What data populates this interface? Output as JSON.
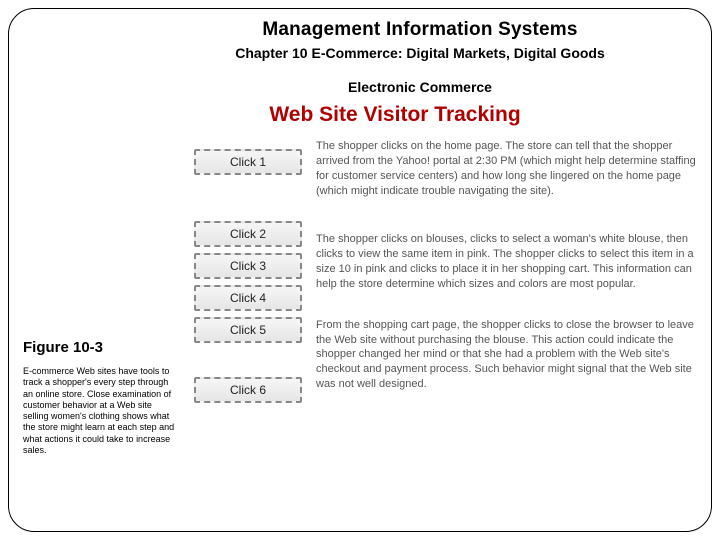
{
  "header": {
    "main": "Management Information Systems",
    "chapter": "Chapter 10 E-Commerce: Digital Markets, Digital Goods",
    "section": "Electronic Commerce",
    "topic": "Web Site Visitor Tracking"
  },
  "figure": {
    "label": "Figure 10-3",
    "caption": "E-commerce Web sites have tools to track a shopper's every step through an online store. Close examination of customer behavior at a Web site selling women's clothing shows what the store might learn at each step and what actions it could take to increase sales."
  },
  "clicks": {
    "c1": "Click 1",
    "c2": "Click 2",
    "c3": "Click 3",
    "c4": "Click 4",
    "c5": "Click 5",
    "c6": "Click 6"
  },
  "descriptions": {
    "d1": "The shopper clicks on the home page. The store can tell that the shopper arrived from the Yahoo! portal at 2:30 PM (which might help determine staffing for customer service centers) and how long she lingered on the home page (which might indicate trouble navigating the site).",
    "d2": "The shopper clicks on blouses, clicks to select a woman's white blouse, then clicks to view the same item in pink. The shopper clicks to select this item in a size 10 in pink and clicks to place it in her shopping cart. This information can help the store determine which sizes and colors are most popular.",
    "d3": "From the shopping cart page, the shopper clicks to close the browser to leave the Web site without purchasing the blouse. This action could indicate the shopper changed her mind or that she had a problem with the Web site's checkout and payment process. Such behavior might signal that the Web site was not well designed."
  }
}
